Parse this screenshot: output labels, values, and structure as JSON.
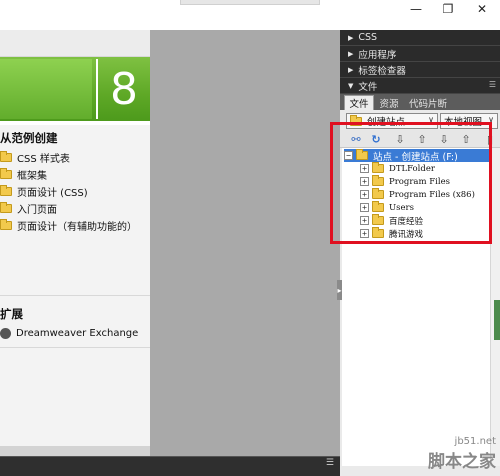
{
  "window": {
    "restore_glyph": "❐",
    "close_glyph": "✕",
    "minimize_glyph": "—"
  },
  "start_page": {
    "version_number": "8",
    "section_create_from_sample": "从范例创建",
    "sample_items": [
      "CSS 样式表",
      "框架集",
      "页面设计 (CSS)",
      "入门页面",
      "页面设计（有辅助功能的）"
    ],
    "section_extend": "扩展",
    "exchange_link": "Dreamweaver Exchange"
  },
  "bottom_panel": {
    "menu_glyph": "☰"
  },
  "panels": {
    "headers": [
      {
        "label": "CSS",
        "expanded": false
      },
      {
        "label": "应用程序",
        "expanded": false
      },
      {
        "label": "标签检查器",
        "expanded": false
      },
      {
        "label": "文件",
        "expanded": true
      }
    ],
    "tabs": [
      "文件",
      "资源",
      "代码片断"
    ],
    "site_select": "创建站点",
    "view_select": "本地视图",
    "toolbar_icons": [
      "connect-icon",
      "refresh-icon",
      "get-files-icon",
      "put-files-icon",
      "check-out-icon",
      "check-in-icon",
      "expand-icon"
    ],
    "tree": {
      "root_label": "站点 - 创建站点 (F:)",
      "children": [
        "DTLFolder",
        "Program Files",
        "Program Files (x86)",
        "Users",
        "百度经验",
        "腾讯游戏"
      ]
    }
  },
  "watermark": {
    "site": "jb51.net",
    "name": "脚本之家"
  },
  "colors": {
    "annotation_red": "#e01020",
    "dreamweaver_green": "#5ea826",
    "panel_dark": "#2b2b2b",
    "selection_blue": "#3a7bd5"
  }
}
